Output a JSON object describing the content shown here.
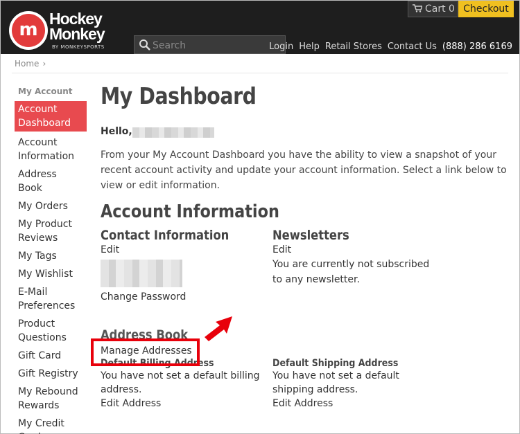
{
  "header": {
    "logo_line1": "Hockey",
    "logo_line2": "Monkey",
    "logo_sub": "BY MONKEYSPORTS",
    "search_placeholder": "Search",
    "cart_label": "Cart 0",
    "checkout_label": "Checkout",
    "nav": {
      "login": "Login",
      "help": "Help",
      "retail": "Retail Stores",
      "contact": "Contact Us",
      "phone": "(888) 286 6169"
    }
  },
  "breadcrumb": {
    "home": "Home",
    "sep": "›"
  },
  "sidebar": {
    "title": "My Account",
    "items": [
      {
        "label": "Account Dashboard"
      },
      {
        "label": "Account Information"
      },
      {
        "label": "Address Book"
      },
      {
        "label": "My Orders"
      },
      {
        "label": "My Product Reviews"
      },
      {
        "label": "My Tags"
      },
      {
        "label": "My Wishlist"
      },
      {
        "label": "E-Mail Preferences"
      },
      {
        "label": "Product Questions"
      },
      {
        "label": "Gift Card"
      },
      {
        "label": "Gift Registry"
      },
      {
        "label": "My Rebound Rewards"
      },
      {
        "label": "My Credit Cards"
      }
    ]
  },
  "main": {
    "title": "My Dashboard",
    "hello": "Hello,",
    "intro": "From your My Account Dashboard you have the ability to view a snapshot of your recent account activity and update your account information. Select a link below to view or edit information.",
    "account_info_title": "Account Information",
    "contact": {
      "title": "Contact Information",
      "edit": "Edit",
      "change_password": "Change Password"
    },
    "newsletters": {
      "title": "Newsletters",
      "edit": "Edit",
      "status": "You are currently not subscribed to any newsletter."
    },
    "address_book": {
      "title": "Address Book",
      "manage": "Manage Addresses",
      "billing_title": "Default Billing Address",
      "billing_text": "You have not set a default billing address.",
      "billing_edit": "Edit Address",
      "shipping_title": "Default Shipping Address",
      "shipping_text": "You have not set a default shipping address.",
      "shipping_edit": "Edit Address"
    }
  },
  "colors": {
    "header_bg": "#1e1e1e",
    "accent_red": "#e84a4f",
    "checkout_yellow": "#f0c020",
    "annotation_red": "#e8000b"
  }
}
